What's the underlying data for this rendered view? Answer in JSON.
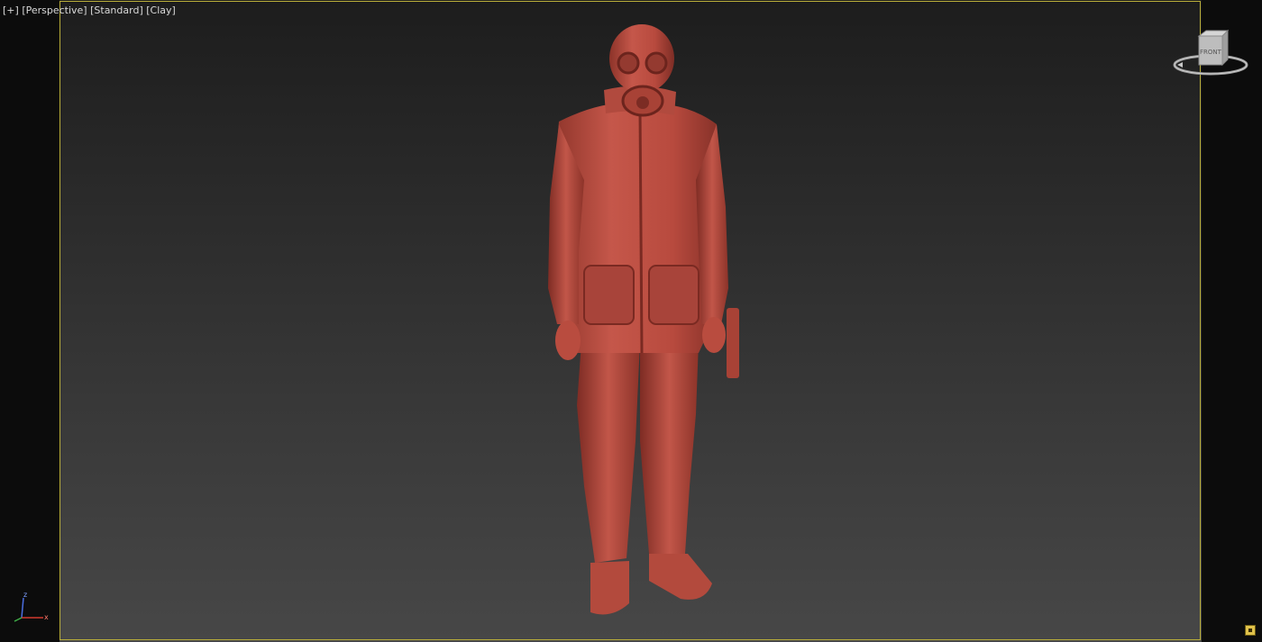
{
  "viewport": {
    "labels": {
      "plus": "[+]",
      "view": "[Perspective]",
      "shading": "[Standard]",
      "style": "[Clay]"
    },
    "viewcube": {
      "face_label": "FRONT"
    },
    "axes": {
      "z": "z",
      "x": "x"
    }
  },
  "colors": {
    "clay": "#b3473a",
    "frame": "#b9ae3a",
    "background_top": "#1b1b1b",
    "background_bottom": "#474747"
  },
  "icons": {
    "viewcube": "viewcube-icon",
    "axis": "axis-tripod-icon",
    "corner": "maximize-toggle-icon"
  }
}
